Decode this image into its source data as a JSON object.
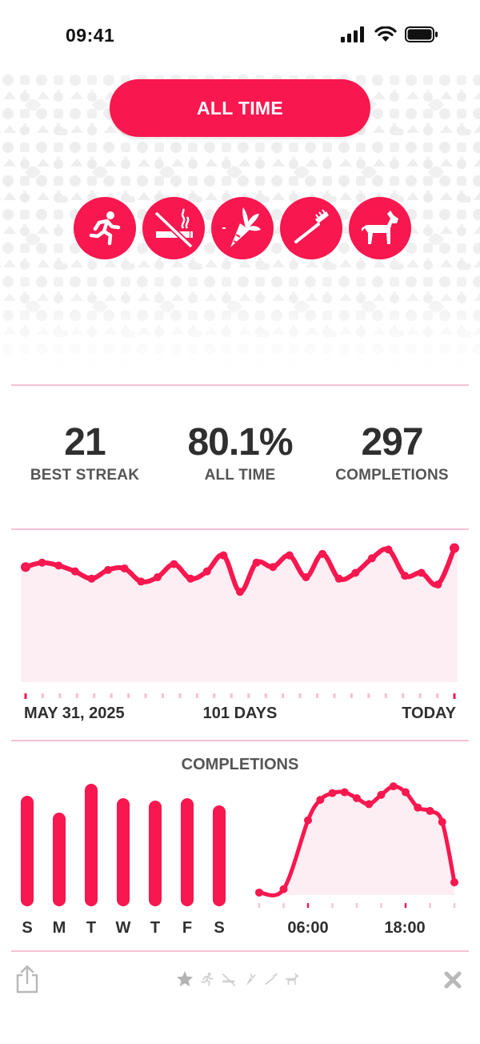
{
  "status_bar": {
    "time": "09:41"
  },
  "period_button": {
    "label": "ALL TIME"
  },
  "habits": [
    {
      "icon": "running-person-icon"
    },
    {
      "icon": "no-smoking-icon"
    },
    {
      "icon": "carrot-icon"
    },
    {
      "icon": "toothbrush-icon"
    },
    {
      "icon": "dog-icon"
    }
  ],
  "stats": {
    "best_streak": {
      "value": "21",
      "label": "BEST STREAK"
    },
    "all_time": {
      "value": "80.1%",
      "label": "ALL TIME"
    },
    "completions": {
      "value": "297",
      "label": "COMPLETIONS"
    }
  },
  "timeline": {
    "start_label": "MAY 31, 2025",
    "span_label": "101 DAYS",
    "end_label": "TODAY"
  },
  "completions_section": {
    "title": "COMPLETIONS",
    "hour_labels": [
      "06:00",
      "18:00"
    ]
  },
  "colors": {
    "accent": "#f8174f",
    "accent_light": "#fdeef3",
    "divider": "#f6c2d2"
  },
  "chart_data": [
    {
      "type": "area",
      "title": "",
      "xlabel": "",
      "ylabel": "",
      "x_range": [
        "MAY 31, 2025",
        "TODAY"
      ],
      "ylim": [
        0,
        100
      ],
      "series": [
        {
          "values": [
            79,
            82,
            80,
            76,
            71,
            77,
            78,
            69,
            72,
            81,
            71,
            76,
            87,
            62,
            82,
            79,
            87,
            72,
            88,
            71,
            75,
            85,
            91,
            73,
            75,
            67,
            92
          ]
        }
      ]
    },
    {
      "type": "bar",
      "title": "COMPLETIONS",
      "categories": [
        "S",
        "M",
        "T",
        "W",
        "T",
        "F",
        "S"
      ],
      "values": [
        46,
        39,
        51,
        45,
        44,
        45,
        42
      ]
    },
    {
      "type": "area",
      "title": "",
      "x_labels": [
        "06:00",
        "18:00"
      ],
      "x_range": [
        0,
        24
      ],
      "x": [
        0,
        3,
        6,
        7.5,
        9,
        10.5,
        12,
        13.5,
        15,
        16.5,
        18,
        19.5,
        21,
        22.5,
        24
      ],
      "values": [
        3,
        7,
        88,
        112,
        120,
        121,
        114,
        107,
        118,
        128,
        121,
        103,
        99,
        86,
        15
      ]
    }
  ]
}
